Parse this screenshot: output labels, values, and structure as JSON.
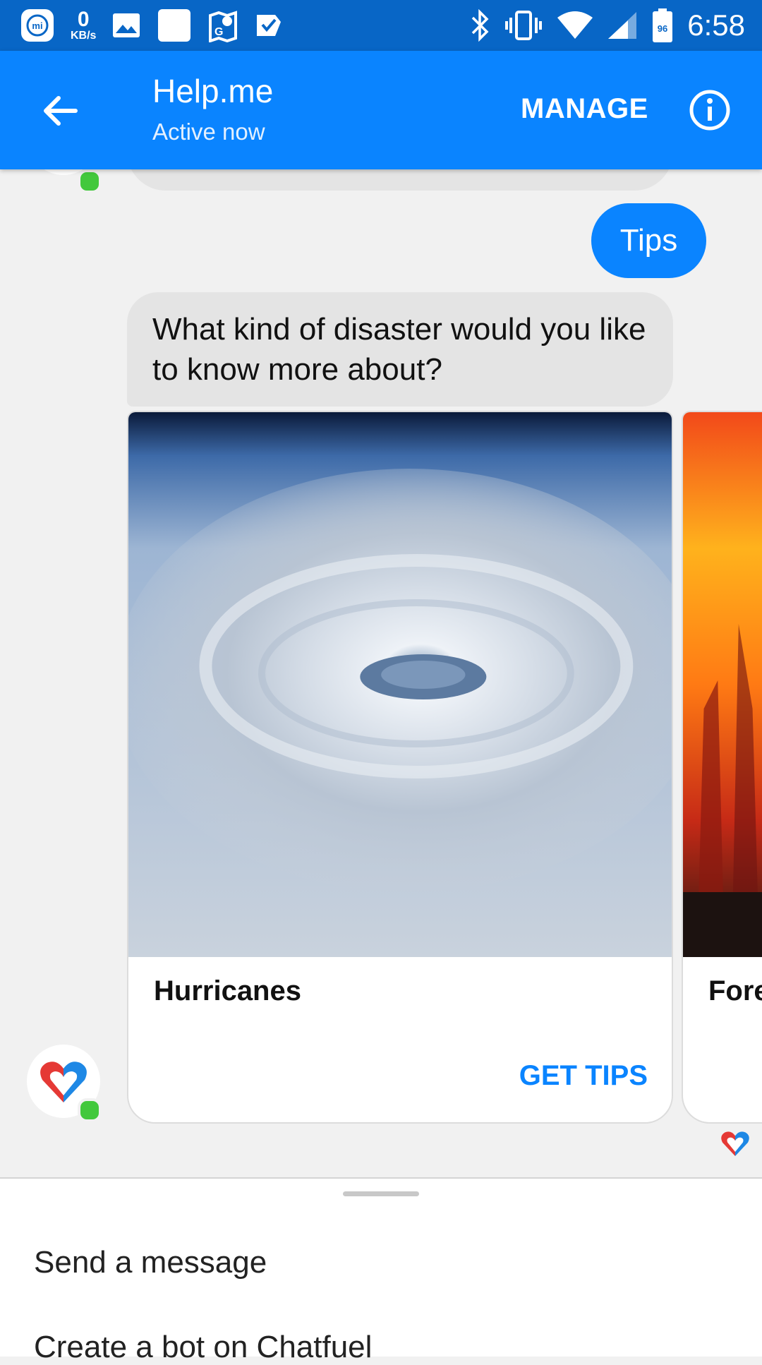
{
  "status_bar": {
    "network_speed_value": "0",
    "network_speed_unit": "KB/s",
    "battery_level": "96",
    "time": "6:58",
    "icons": [
      "mi-icon",
      "image-icon",
      "blank-icon",
      "map-icon",
      "check-icon",
      "bluetooth-icon",
      "vibrate-icon",
      "wifi-icon",
      "signal-icon",
      "battery-icon"
    ]
  },
  "header": {
    "title": "Help.me",
    "subtitle": "Active now",
    "manage_label": "MANAGE",
    "accent_color": "#0a84ff"
  },
  "messages": {
    "user_reply": "Tips",
    "bot_question": "What kind of disaster would you like to know more about?"
  },
  "carousel": {
    "cards": [
      {
        "title": "Hurricanes",
        "button_label": "GET TIPS",
        "image": "hurricane-satellite-image"
      },
      {
        "title": "Fore",
        "image": "forest-fire-image"
      }
    ]
  },
  "composer": {
    "items": [
      "Send a message",
      "Create a bot on Chatfuel"
    ]
  }
}
